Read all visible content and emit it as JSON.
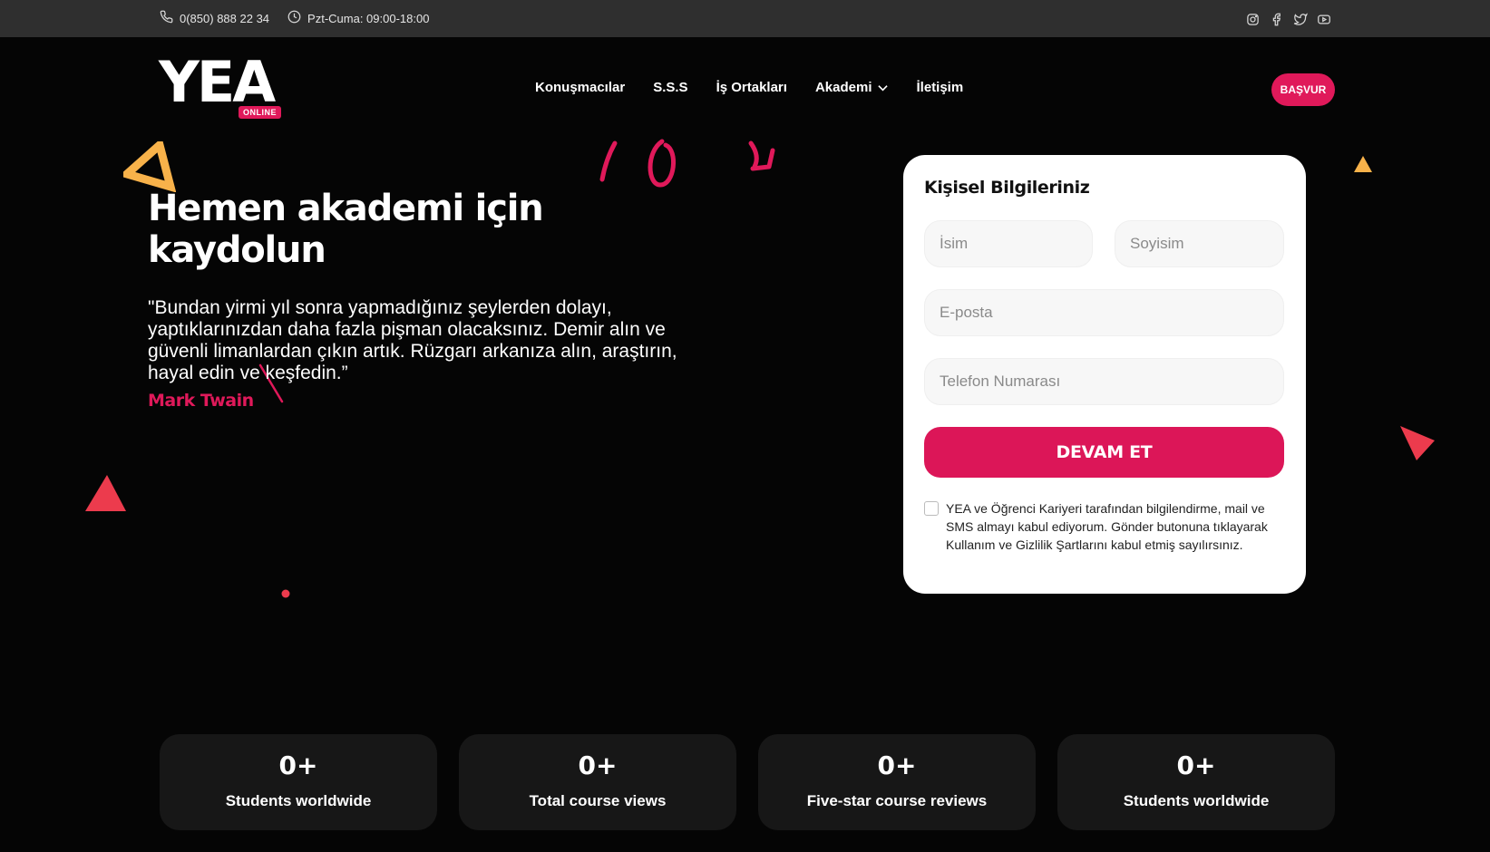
{
  "topbar": {
    "phone": "0(850) 888 22 34",
    "hours": "Pzt-Cuma: 09:00-18:00",
    "socials": [
      "instagram-icon",
      "facebook-icon",
      "twitter-icon",
      "youtube-icon"
    ]
  },
  "header": {
    "logo_text": "YEA",
    "logo_badge": "ONLINE",
    "nav": [
      {
        "label": "Konuşmacılar"
      },
      {
        "label": "S.S.S"
      },
      {
        "label": "İş Ortakları"
      },
      {
        "label": "Akademi"
      },
      {
        "label": "İletişim"
      }
    ],
    "apply_label": "BAŞVUR"
  },
  "hero": {
    "title_line1": "Hemen akademi için",
    "title_line2": "kaydolun",
    "quote": "\"Bundan yirmi yıl sonra yapmadığınız şeylerden dolayı, yaptıklarınızdan daha fazla pişman olacaksınız. Demir alın ve güvenli limanlardan çıkın artık. Rüzgarı arkanıza alın, araştırın, hayal edin ve keşfedin.”",
    "author": "Mark Twain"
  },
  "form": {
    "title": "Kişisel Bilgileriniz",
    "first_name_placeholder": "İsim",
    "last_name_placeholder": "Soyisim",
    "email_placeholder": "E-posta",
    "phone_placeholder": "Telefon Numarası",
    "submit_label": "DEVAM ET",
    "consent_text": "YEA ve Öğrenci Kariyeri tarafından bilgilendirme, mail ve SMS almayı kabul ediyorum. Gönder butonuna tıklayarak Kullanım ve Gizlilik Şartlarını kabul etmiş sayılırsınız.",
    "consent_checked": false
  },
  "stats": [
    {
      "value": "0+",
      "label": "Students worldwide"
    },
    {
      "value": "0+",
      "label": "Total course views"
    },
    {
      "value": "0+",
      "label": "Five-star course reviews"
    },
    {
      "value": "0+",
      "label": "Students worldwide"
    }
  ],
  "colors": {
    "accent": "#e0195a",
    "yellow": "#f8b24a",
    "red_shape": "#ec3b4d",
    "topbar": "#2f2f2f",
    "stat_card": "#171717"
  }
}
